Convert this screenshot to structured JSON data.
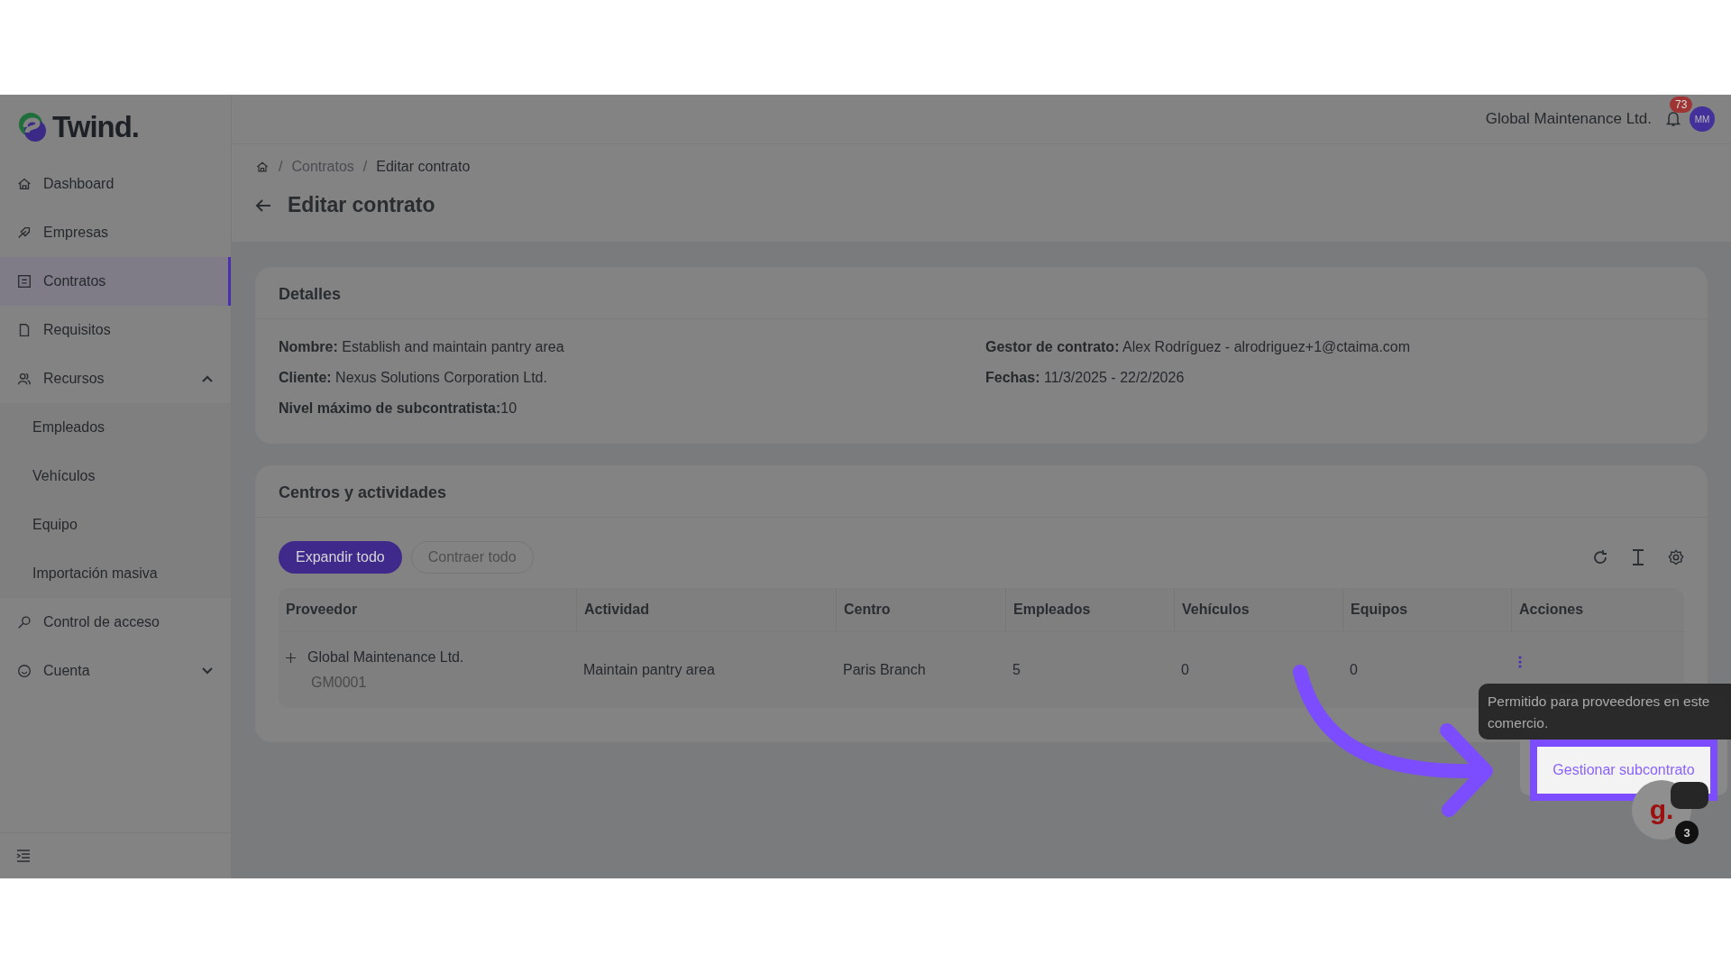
{
  "logo": {
    "text": "Twind."
  },
  "sidebar": {
    "items": [
      {
        "label": "Dashboard",
        "selected": false
      },
      {
        "label": "Empresas",
        "selected": false
      },
      {
        "label": "Contratos",
        "selected": true
      },
      {
        "label": "Requisitos",
        "selected": false
      },
      {
        "label": "Recursos",
        "selected": false,
        "expanded": true,
        "children": [
          {
            "label": "Empleados"
          },
          {
            "label": "Vehículos"
          },
          {
            "label": "Equipo"
          },
          {
            "label": "Importación masiva"
          }
        ]
      },
      {
        "label": "Control de acceso",
        "selected": false
      },
      {
        "label": "Cuenta",
        "selected": false,
        "expanded": false
      }
    ]
  },
  "header": {
    "company": "Global Maintenance Ltd.",
    "notifications": "73",
    "avatar": "MM"
  },
  "breadcrumb": [
    {
      "separator": "/",
      "label": "Contratos"
    },
    {
      "separator": "/",
      "label": "Editar contrato"
    }
  ],
  "title": "Editar contrato",
  "details": {
    "title": "Detalles",
    "left": [
      "**Nombre:** Establish and maintain pantry area",
      "**Cliente:** Nexus Solutions Corporation Ltd.",
      "**Nivel máximo de subcontratista:**10"
    ],
    "right": [
      "**Gestor de contrato:** Alex Rodríguez - alrodriguez+1@ctaima.com",
      "**Fechas:** 11/3/2025 - 22/2/2026"
    ]
  },
  "centers": {
    "title": "Centros y actividades",
    "buttons": [
      {
        "label": "Expandir todo",
        "disabled": false
      },
      {
        "label": "Contraer todo",
        "disabled": true
      }
    ],
    "table": {
      "columns": [
        "Proveedor",
        "Actividad",
        "Centro",
        "Empleados",
        "Vehículos",
        "Equipos",
        "Acciones"
      ],
      "rows": [
        {
          "cells": [
            "Global Maintenance Ltd.",
            "Maintain pantry area",
            "Paris Branch",
            "5",
            "0",
            "0"
          ],
          "code": "GM0001"
        }
      ]
    }
  },
  "menu": {
    "items": [
      {
        "label": "Gestionar subcontrato",
        "highlighted": true
      }
    ]
  },
  "tooltip": "Permitido para proveedores en este comercio.",
  "chat": {
    "logo": "g.",
    "badge": "3"
  }
}
